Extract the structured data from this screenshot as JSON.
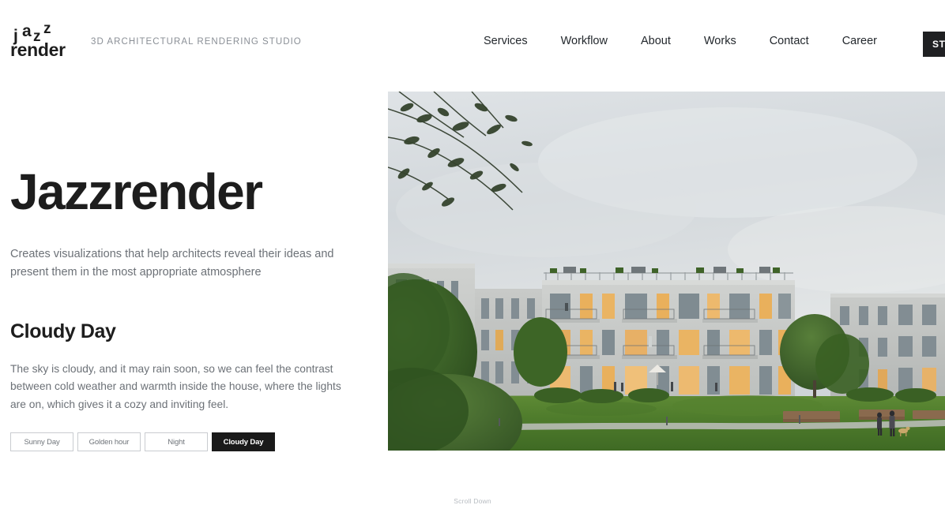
{
  "header": {
    "logo": {
      "line1": "jazz",
      "j": "j",
      "a": "a",
      "z1": "z",
      "z2": "z",
      "line2": "render"
    },
    "tagline": "3D ARCHITECTURAL RENDERING STUDIO",
    "nav": [
      {
        "label": "Services"
      },
      {
        "label": "Workflow"
      },
      {
        "label": "About"
      },
      {
        "label": "Works"
      },
      {
        "label": "Contact"
      },
      {
        "label": "Career"
      }
    ],
    "cta": {
      "label": "START PROJECT"
    }
  },
  "hero": {
    "title": "Jazzrender",
    "subtitle": "Creates visualizations that help architects reveal their ideas and present them in the most appropriate atmosphere"
  },
  "atmosphere": {
    "title": "Cloudy Day",
    "description": "The sky is cloudy, and it may rain soon, so we can feel the contrast between cold weather and warmth inside the house, where the lights are on, which gives it a cozy and inviting feel.",
    "options": [
      {
        "label": "Sunny Day",
        "active": false
      },
      {
        "label": "Golden hour",
        "active": false
      },
      {
        "label": "Night",
        "active": false
      },
      {
        "label": "Cloudy Day",
        "active": true
      }
    ]
  },
  "footer": {
    "scroll_label": "Scroll Down"
  },
  "colors": {
    "background": "#ffffff",
    "text_dark": "#1d1d1d",
    "text_muted": "#6c7177",
    "tagline_grey": "#8a8f96",
    "accent_dark": "#1a1a1a",
    "border_grey": "#c9ccd0",
    "sky": "#d3d8dc",
    "grass": "#4d7b2e",
    "building": "#c6c8c7",
    "window_light": "#e8a84a"
  }
}
